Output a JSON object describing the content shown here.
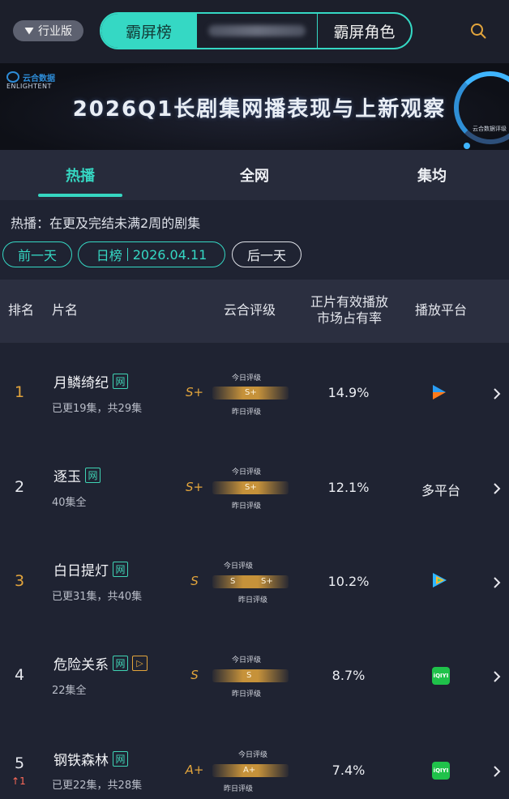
{
  "topbar": {
    "industry_label": "行业版",
    "tabs": [
      "霸屏榜",
      "",
      "霸屏角色"
    ],
    "search_icon": "search-icon"
  },
  "banner": {
    "logo_cn": "云合数据",
    "logo_en": "ENLIGHTENT",
    "title": "2026Q1长剧集网播表现与上新观察",
    "tag": "云合数据评级"
  },
  "tabs": [
    "热播",
    "全网",
    "集均"
  ],
  "description": "热播：在更及完结未满2周的剧集",
  "date_nav": {
    "prev": "前一天",
    "type": "日榜",
    "date": "2026.04.11",
    "next": "后一天"
  },
  "table": {
    "headers": {
      "rank": "排名",
      "name": "片名",
      "grade": "云合评级",
      "share_line1": "正片有效播放",
      "share_line2": "市场占有率",
      "platform": "播放平台"
    },
    "meter_today": "今日评级",
    "meter_yesterday": "昨日评级",
    "rows": [
      {
        "rank": "1",
        "title": "月鳞绮纪",
        "badge": "网",
        "extra_badge": "",
        "sub": "已更19集，共29集",
        "grade": "S+",
        "today": "S+",
        "yesterday": "",
        "share": "14.9%",
        "platform": "",
        "platform_icon": "youku-icon",
        "change": ""
      },
      {
        "rank": "2",
        "title": "逐玉",
        "badge": "网",
        "extra_badge": "",
        "sub": "40集全",
        "grade": "S+",
        "today": "S+",
        "yesterday": "",
        "share": "12.1%",
        "platform": "多平台",
        "platform_icon": "",
        "change": ""
      },
      {
        "rank": "3",
        "title": "白日提灯",
        "badge": "网",
        "extra_badge": "",
        "sub": "已更31集，共40集",
        "grade": "S",
        "today": "S",
        "yesterday": "S+",
        "share": "10.2%",
        "platform": "",
        "platform_icon": "tencent-video-icon",
        "change": ""
      },
      {
        "rank": "4",
        "title": "危险关系",
        "badge": "网",
        "extra_badge": "▷",
        "sub": "22集全",
        "grade": "S",
        "today": "S",
        "yesterday": "",
        "share": "8.7%",
        "platform": "",
        "platform_icon": "iqiyi-icon",
        "change": ""
      },
      {
        "rank": "5",
        "title": "钢铁森林",
        "badge": "网",
        "extra_badge": "",
        "sub": "已更22集，共28集",
        "grade": "A+",
        "today": "A+",
        "yesterday": "",
        "share": "7.4%",
        "platform": "",
        "platform_icon": "iqiyi-icon",
        "change": "1"
      }
    ]
  },
  "colors": {
    "accent": "#35d8c4",
    "gold": "#e3a53c",
    "background": "#1f2332"
  }
}
